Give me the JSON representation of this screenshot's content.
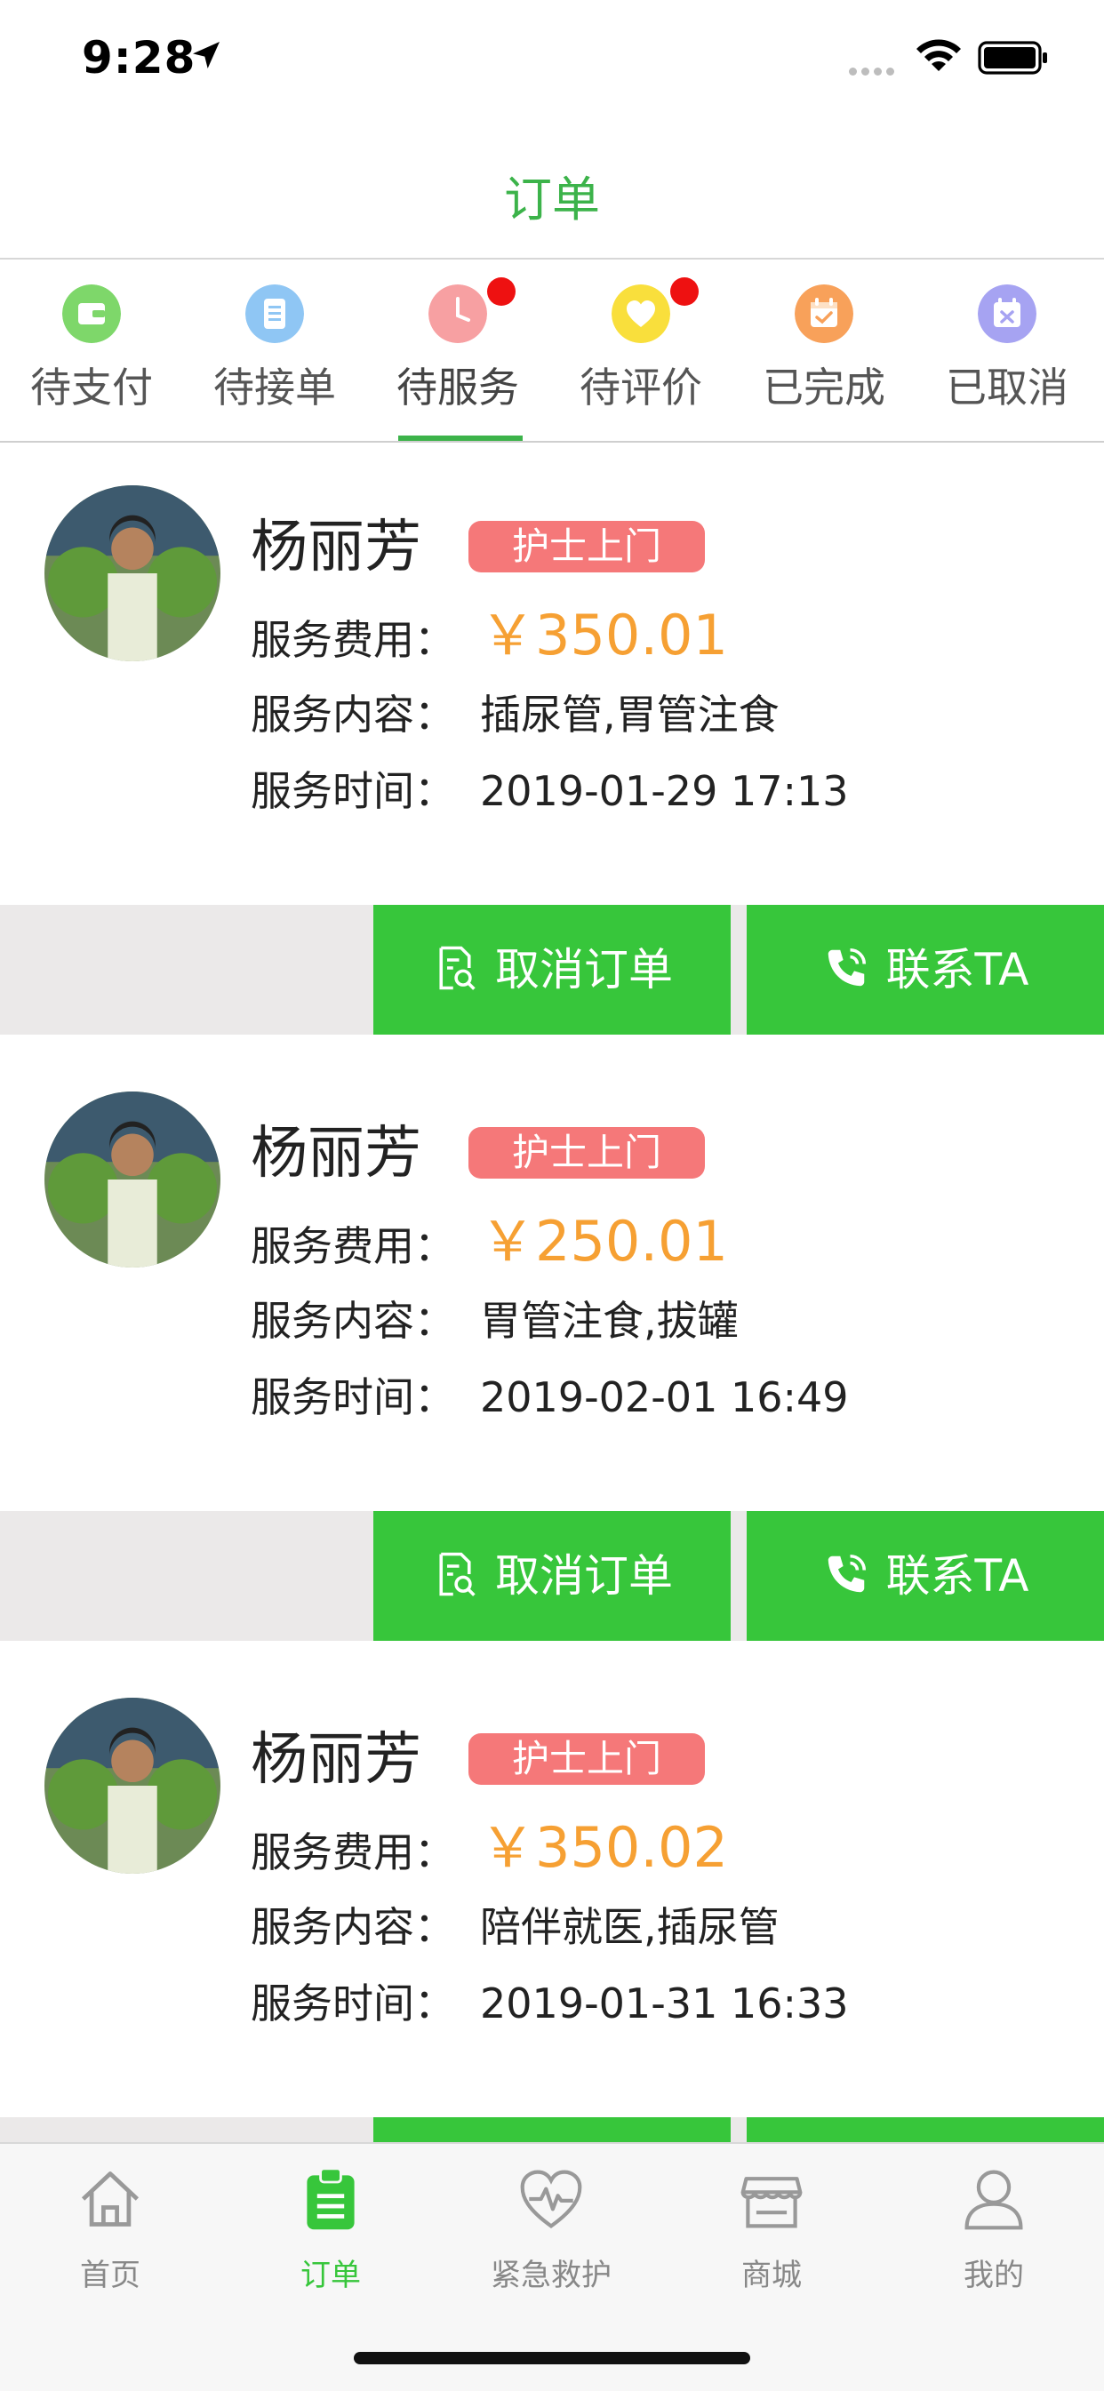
{
  "status_bar": {
    "time": "9:28"
  },
  "nav": {
    "title": "订单"
  },
  "tabs": [
    {
      "label": "待支付",
      "icon": "wallet-icon",
      "color": "#7ed76a",
      "has_dot": false
    },
    {
      "label": "待接单",
      "icon": "list-icon",
      "color": "#8fc6f4",
      "has_dot": false
    },
    {
      "label": "待服务",
      "icon": "clock-icon",
      "color": "#f7a0a2",
      "has_dot": true
    },
    {
      "label": "待评价",
      "icon": "heart-icon",
      "color": "#f9df3c",
      "has_dot": true
    },
    {
      "label": "已完成",
      "icon": "calendar-check-icon",
      "color": "#f8a15a",
      "has_dot": false
    },
    {
      "label": "已取消",
      "icon": "calendar-x-icon",
      "color": "#a6a3f2",
      "has_dot": false
    }
  ],
  "active_tab": 2,
  "orders": [
    {
      "name": "杨丽芳",
      "badge": "护士上门",
      "fee_label": "服务费用：",
      "fee": "￥350.01",
      "content_label": "服务内容：",
      "content": "插尿管,胃管注食",
      "time_label": "服务时间：",
      "time": "2019-01-29 17:13",
      "cancel_label": "取消订单",
      "contact_label": "联系TA"
    },
    {
      "name": "杨丽芳",
      "badge": "护士上门",
      "fee_label": "服务费用：",
      "fee": "￥250.01",
      "content_label": "服务内容：",
      "content": "胃管注食,拔罐",
      "time_label": "服务时间：",
      "time": "2019-02-01 16:49",
      "cancel_label": "取消订单",
      "contact_label": "联系TA"
    },
    {
      "name": "杨丽芳",
      "badge": "护士上门",
      "fee_label": "服务费用：",
      "fee": "￥350.02",
      "content_label": "服务内容：",
      "content": "陪伴就医,插尿管",
      "time_label": "服务时间：",
      "time": "2019-01-31 16:33",
      "cancel_label": "取消订单",
      "contact_label": "联系TA"
    }
  ],
  "tabbar": [
    {
      "label": "首页",
      "icon": "home-icon",
      "active": false
    },
    {
      "label": "订单",
      "icon": "clipboard-icon",
      "active": true
    },
    {
      "label": "紧急救护",
      "icon": "heartbeat-icon",
      "active": false
    },
    {
      "label": "商城",
      "icon": "store-icon",
      "active": false
    },
    {
      "label": "我的",
      "icon": "user-icon",
      "active": false
    }
  ],
  "colors": {
    "accent_green": "#3cb34a",
    "button_green": "#37c63b",
    "price_orange": "#f6a033",
    "badge_red": "#f57879",
    "dot_red": "#ee1111"
  }
}
